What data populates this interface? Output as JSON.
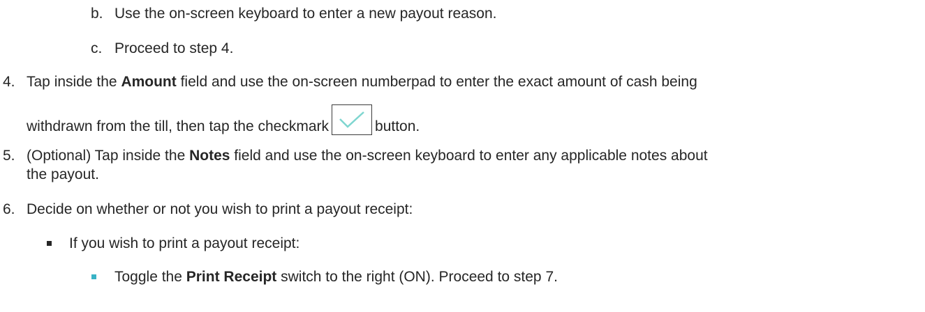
{
  "sub_b": {
    "marker": "b.",
    "text": "Use the on-screen keyboard to enter a new payout reason."
  },
  "sub_c": {
    "marker": "c.",
    "text": "Proceed to step 4."
  },
  "step4": {
    "marker": "4.",
    "p1": "Tap inside the ",
    "bold1": "Amount",
    "p2": " field and use the on-screen numberpad to enter the exact amount of cash being",
    "p3": "withdrawn from the till, then tap the checkmark",
    "p4": "button."
  },
  "step5": {
    "marker": "5.",
    "p1": "(Optional) Tap inside the ",
    "bold1": "Notes",
    "p2": " field and use the on-screen keyboard to enter any applicable notes about",
    "p3": "the payout."
  },
  "step6": {
    "marker": "6.",
    "text": "Decide on whether or not you wish to print a payout receipt:"
  },
  "bullet1": {
    "text": "If you wish to print a payout receipt:"
  },
  "bullet2": {
    "p1": "Toggle the ",
    "bold1": "Print Receipt",
    "p2": " switch to the right (ON). Proceed to step 7."
  },
  "icons": {
    "checkmark": "checkmark-icon"
  },
  "colors": {
    "checkmark": "#7fd6d0",
    "bullet_dark": "#262626",
    "bullet_teal": "#39b3c6"
  }
}
